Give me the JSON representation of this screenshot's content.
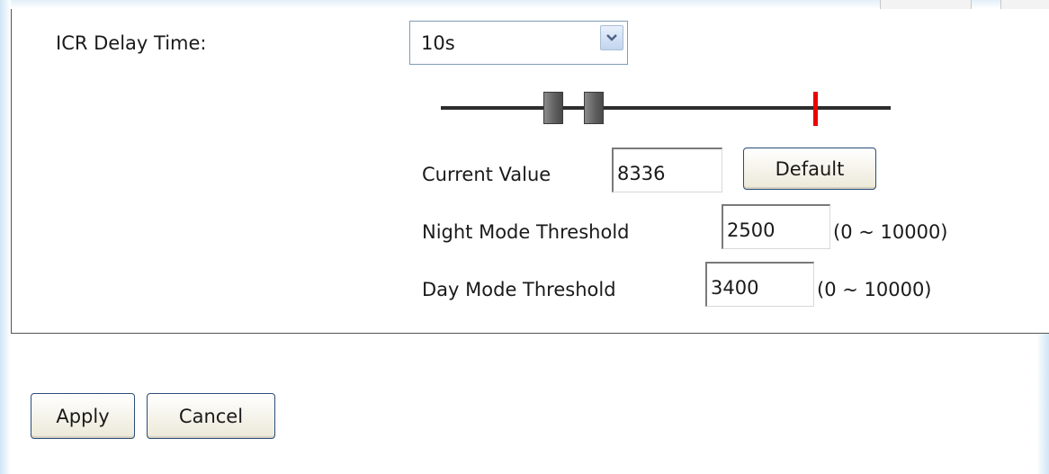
{
  "icr_delay": {
    "label": "ICR Delay Time:",
    "selected": "10s"
  },
  "light_sensor": {
    "current_value_label": "Current Value",
    "current_value": "8336",
    "default_button": "Default",
    "night_label": "Night Mode Threshold",
    "night_value": "2500",
    "night_range": "(0 ~ 10000)",
    "day_label": "Day Mode Threshold",
    "day_value": "3400",
    "day_range": "(0 ~ 10000)",
    "slider": {
      "min": 0,
      "max": 10000,
      "night_threshold": 2500,
      "day_threshold": 3400,
      "current_value": 8336,
      "thumb_color": "#5e5e5e",
      "marker_color": "#ee0000"
    }
  },
  "actions": {
    "apply": "Apply",
    "cancel": "Cancel"
  },
  "colors": {
    "accent_edge": "#cfe6f5",
    "button_border": "#2a4d7a"
  }
}
